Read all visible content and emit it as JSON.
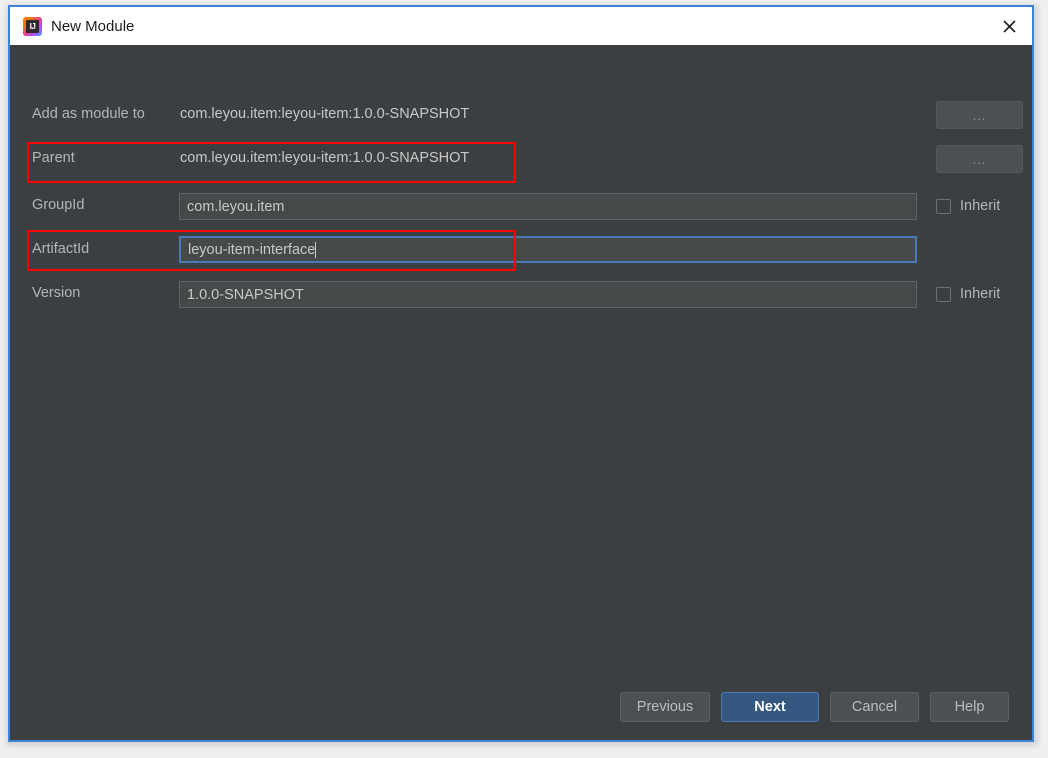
{
  "window": {
    "title": "New Module",
    "app_icon": "intellij-idea-icon",
    "close_icon": "close-icon",
    "accent_border": "#3d84d8",
    "background": "#3c3f41",
    "field_background": "#45494a",
    "focus_border": "#4a78b4",
    "annotation_color": "#fe0000",
    "default_button_color": "#365880"
  },
  "form": {
    "rows": [
      {
        "label": "Add as module to",
        "type": "static",
        "value": "com.leyou.item:leyou-item:1.0.0-SNAPSHOT",
        "side_control": "dots-button",
        "side_label": "...",
        "highlighted": false
      },
      {
        "label": "Parent",
        "type": "static",
        "value": "com.leyou.item:leyou-item:1.0.0-SNAPSHOT",
        "side_control": "dots-button",
        "side_label": "...",
        "highlighted": true
      },
      {
        "label": "GroupId",
        "type": "input",
        "value": "com.leyou.item",
        "side_control": "checkbox",
        "side_label": "Inherit",
        "checked": false,
        "focused": false,
        "highlighted": false
      },
      {
        "label": "ArtifactId",
        "type": "input",
        "value": "leyou-item-interface",
        "side_control": "none",
        "side_label": "",
        "checked": false,
        "focused": true,
        "highlighted": true
      },
      {
        "label": "Version",
        "type": "input",
        "value": "1.0.0-SNAPSHOT",
        "side_control": "checkbox",
        "side_label": "Inherit",
        "checked": false,
        "focused": false,
        "highlighted": false
      }
    ]
  },
  "footer": {
    "buttons": [
      {
        "label": "Previous",
        "default": false
      },
      {
        "label": "Next",
        "default": true
      },
      {
        "label": "Cancel",
        "default": false
      },
      {
        "label": "Help",
        "default": false
      }
    ]
  }
}
